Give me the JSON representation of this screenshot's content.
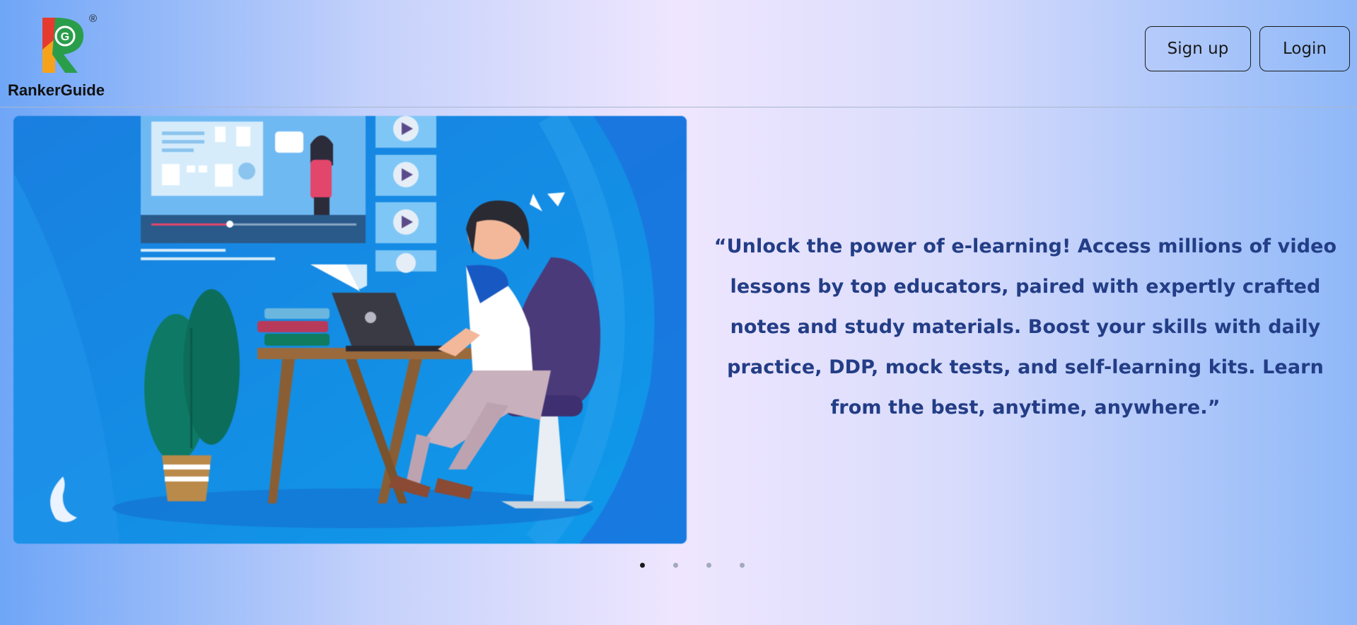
{
  "brand": {
    "name": "RankerGuide",
    "logo_letter": "R",
    "logo_inner_letter": "G",
    "registered_mark": "®"
  },
  "header": {
    "signup_label": "Sign up",
    "login_label": "Login"
  },
  "hero": {
    "illustration": "woman-studying-laptop-elearning",
    "quote": "“Unlock the power of e-learning! Access millions of video lessons by top educators, paired with expertly crafted notes and study materials. Boost your skills with daily practice, DDP, mock tests, and self-learning kits. Learn from the best, anytime, anywhere.”"
  },
  "carousel": {
    "slide_count": 4,
    "active_index": 0
  },
  "colors": {
    "quote_text": "#233d86",
    "illustration_bg": "#1d8be6",
    "active_dot": "#1a1a1a",
    "inactive_dot": "#a2a9bd"
  }
}
